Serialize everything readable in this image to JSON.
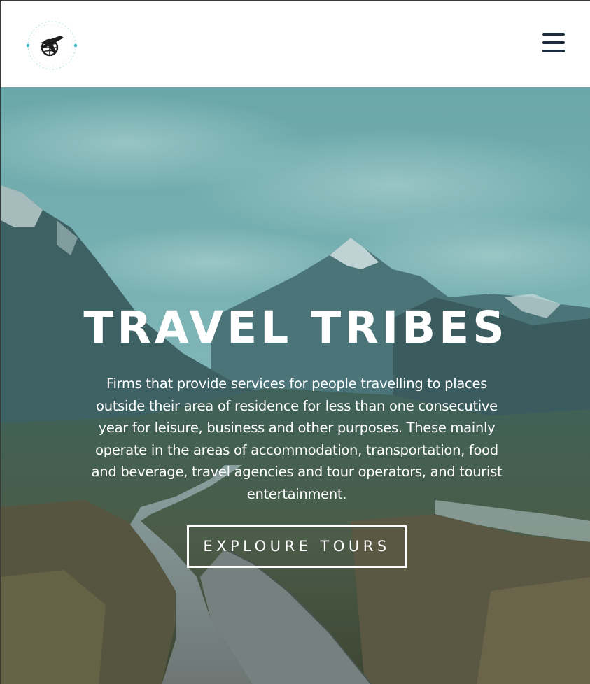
{
  "header": {
    "logo_icon": "travel-globe-plane-logo",
    "menu_icon": "hamburger-menu-icon",
    "menu_color": "#1c2a3d"
  },
  "hero": {
    "title": "TRAVEL TRIBES",
    "description": "Firms that provide services for people travelling to places outside their area of residence for less than one consecutive year for leisure, business and other purposes. These mainly operate in the areas of accommodation, transportation, food and beverage, travel agencies and tour operators, and tourist entertainment.",
    "cta_label": "EXPLOURE TOURS",
    "background": "mountain-valley-boardwalk-photo",
    "overlay_color": "#3d7a7c"
  }
}
